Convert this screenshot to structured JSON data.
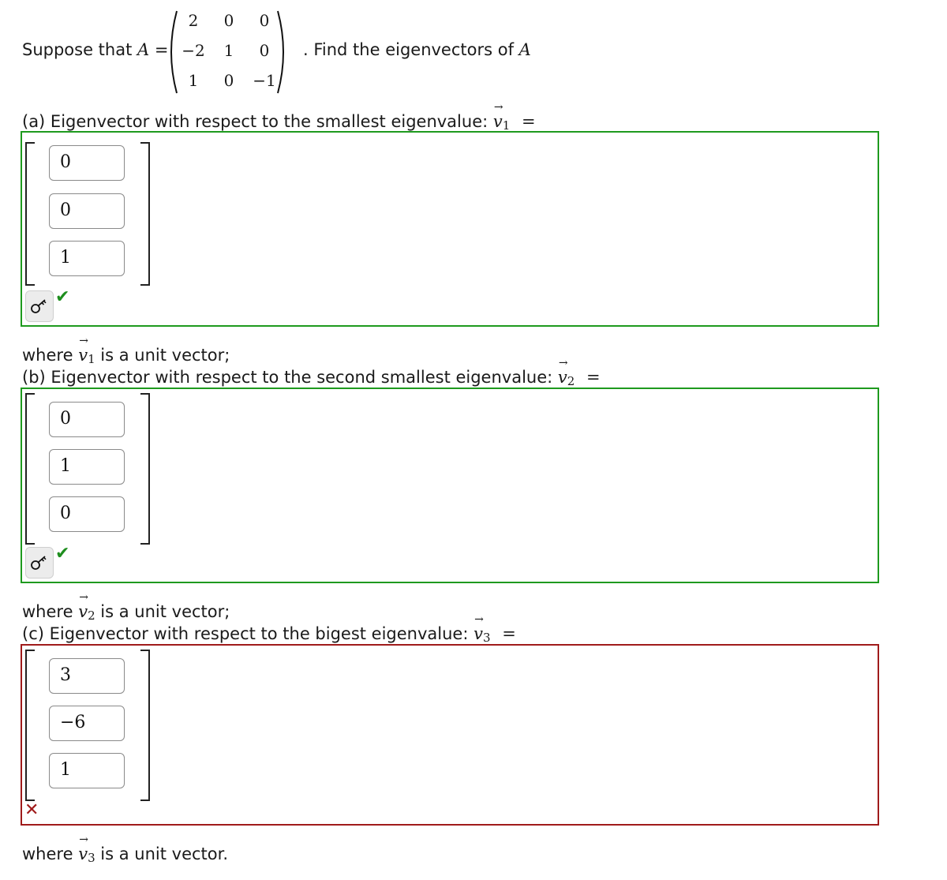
{
  "problem": {
    "intro": "Suppose that",
    "matrix_name": "A",
    "equals": "=",
    "matrix": [
      [
        "2",
        "0",
        "0"
      ],
      [
        "−2",
        "1",
        "0"
      ],
      [
        "1",
        "0",
        "−1"
      ]
    ],
    "find_prefix": ". Find the eigenvectors of",
    "find_var": "A"
  },
  "parts": [
    {
      "label": "(a) Eigenvector with respect to the smallest eigenvalue:",
      "vector_symbol": "v",
      "vector_index": "1",
      "equals": "=",
      "entries": [
        "0",
        "0",
        "1"
      ],
      "status": "correct",
      "status_color": "#1e9a1e",
      "note_prefix": "where",
      "note_suffix": "is a unit vector;"
    },
    {
      "label": "(b) Eigenvector with respect to the second smallest eigenvalue:",
      "vector_symbol": "v",
      "vector_index": "2",
      "equals": "=",
      "entries": [
        "0",
        "1",
        "0"
      ],
      "status": "correct",
      "status_color": "#1e9a1e",
      "note_prefix": "where",
      "note_suffix": "is a unit vector;"
    },
    {
      "label": "(c) Eigenvector with respect to the bigest eigenvalue:",
      "vector_symbol": "v",
      "vector_index": "3",
      "equals": "=",
      "entries": [
        "3",
        "−6",
        "1"
      ],
      "status": "incorrect",
      "status_color": "#a01b1b",
      "note_prefix": "where",
      "note_suffix": "is a unit vector."
    }
  ],
  "icons": {
    "arrow": "→",
    "check": "✔",
    "cross": "✕",
    "key": "key-icon"
  }
}
